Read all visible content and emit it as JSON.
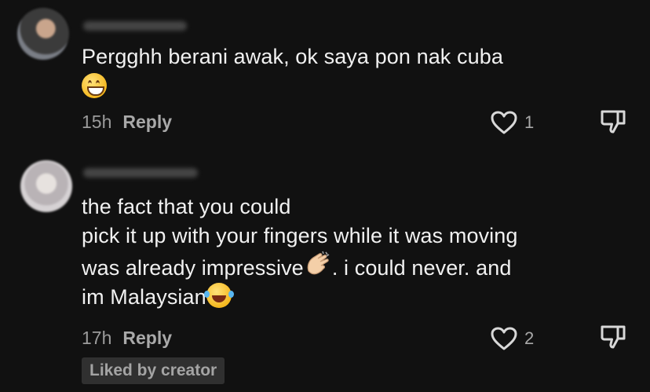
{
  "comments": [
    {
      "text_lines": [
        "Pergghh berani awak, ok saya pon nak cuba"
      ],
      "time": "15h",
      "reply_label": "Reply",
      "likes": "1"
    },
    {
      "text_lines": [
        "the fact that you could",
        "pick it up with your fingers while it was moving",
        "was already impressive",
        ". i could never. and",
        "im Malaysian"
      ],
      "time": "17h",
      "reply_label": "Reply",
      "likes": "2",
      "badge": "Liked by creator"
    }
  ],
  "icons": {
    "like": "heart-outline-icon",
    "dislike": "thumbs-down-icon",
    "emoji_1": "grinning-face-emoji",
    "emoji_2": "clapping-hands-emoji",
    "emoji_3": "face-with-tears-of-joy-emoji"
  },
  "colors": {
    "background": "#111111",
    "text": "#f1f1f1",
    "muted": "#9b9b9b",
    "badge_bg": "#303030"
  }
}
